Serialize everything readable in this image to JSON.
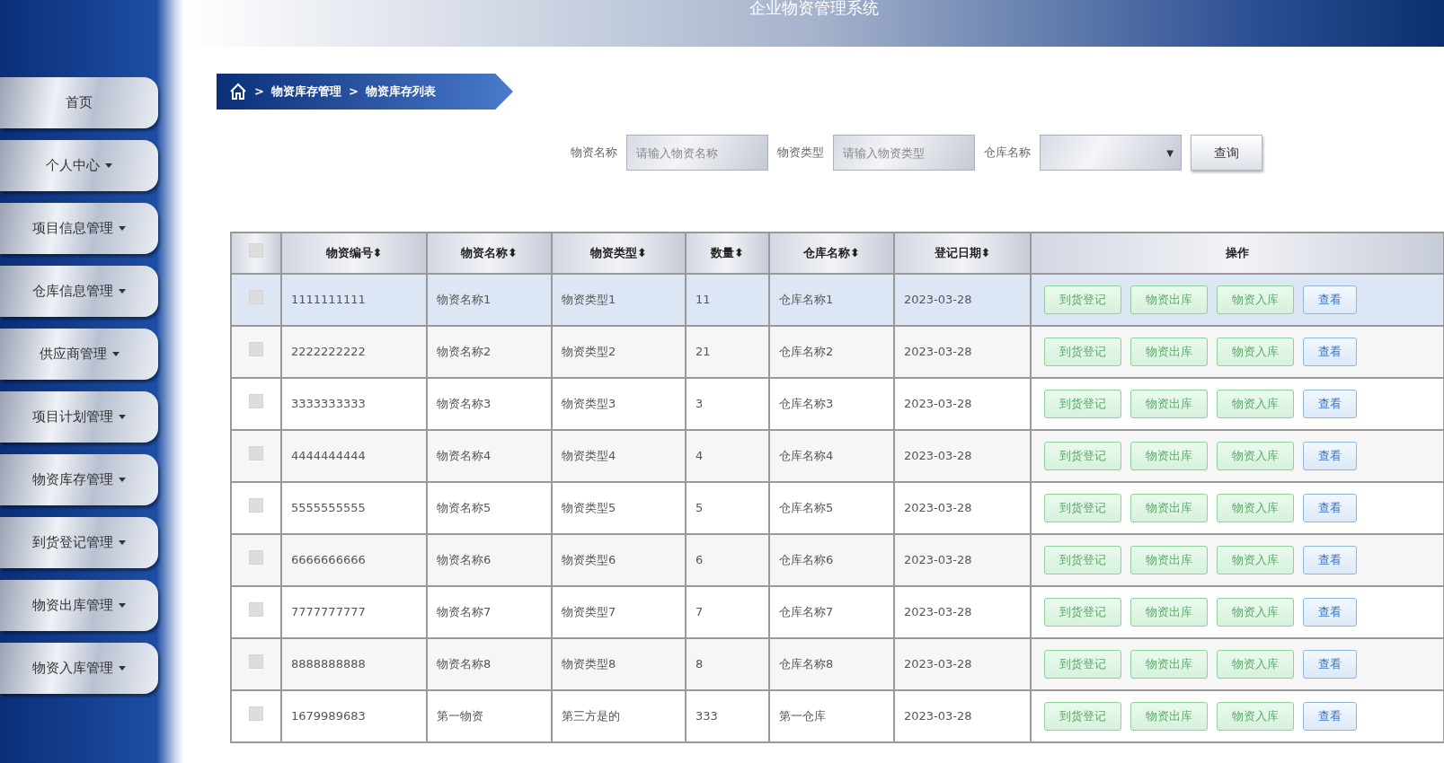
{
  "header": {
    "title": "企业物资管理系统"
  },
  "sidebar": {
    "items": [
      {
        "label": "首页",
        "kind": "link"
      },
      {
        "label": "个人中心",
        "kind": "menu"
      },
      {
        "label": "项目信息管理",
        "kind": "menu"
      },
      {
        "label": "仓库信息管理",
        "kind": "menu"
      },
      {
        "label": "供应商管理",
        "kind": "menu"
      },
      {
        "label": "项目计划管理",
        "kind": "menu"
      },
      {
        "label": "物资库存管理",
        "kind": "menu"
      },
      {
        "label": "到货登记管理",
        "kind": "menu"
      },
      {
        "label": "物资出库管理",
        "kind": "menu"
      },
      {
        "label": "物资入库管理",
        "kind": "menu"
      }
    ]
  },
  "breadcrumb": {
    "separator": ">",
    "items": [
      "物资库存管理",
      "物资库存列表"
    ]
  },
  "search": {
    "fields": [
      {
        "kind": "input",
        "label": "物资名称",
        "placeholder": "请输入物资名称"
      },
      {
        "kind": "input",
        "label": "物资类型",
        "placeholder": "请输入物资类型"
      },
      {
        "kind": "select",
        "label": "仓库名称",
        "caret": "▼"
      }
    ],
    "button": "查询"
  },
  "table": {
    "select_all_checked": false,
    "columns": [
      {
        "label": "物资编号",
        "sort_icon": "⬍"
      },
      {
        "label": "物资名称",
        "sort_icon": "⬍"
      },
      {
        "label": "物资类型",
        "sort_icon": "⬍"
      },
      {
        "label": "数量",
        "sort_icon": "⬍"
      },
      {
        "label": "仓库名称",
        "sort_icon": "⬍"
      },
      {
        "label": "登记日期",
        "sort_icon": "⬍"
      },
      {
        "label": "操作"
      }
    ],
    "rows": [
      {
        "cells": [
          "1111111111",
          "物资名称1",
          "物资类型1",
          "11",
          "仓库名称1",
          "2023-03-28"
        ],
        "selected": true,
        "checked": false,
        "actions": [
          {
            "label": "到货登记",
            "kind": "success"
          },
          {
            "label": "物资出库",
            "kind": "success"
          },
          {
            "label": "物资入库",
            "kind": "success"
          },
          {
            "label": "查看",
            "kind": "info"
          }
        ]
      },
      {
        "cells": [
          "2222222222",
          "物资名称2",
          "物资类型2",
          "21",
          "仓库名称2",
          "2023-03-28"
        ],
        "selected": false,
        "checked": false,
        "actions": [
          {
            "label": "到货登记",
            "kind": "success"
          },
          {
            "label": "物资出库",
            "kind": "success"
          },
          {
            "label": "物资入库",
            "kind": "success"
          },
          {
            "label": "查看",
            "kind": "info"
          }
        ]
      },
      {
        "cells": [
          "3333333333",
          "物资名称3",
          "物资类型3",
          "3",
          "仓库名称3",
          "2023-03-28"
        ],
        "selected": false,
        "checked": false,
        "actions": [
          {
            "label": "到货登记",
            "kind": "success"
          },
          {
            "label": "物资出库",
            "kind": "success"
          },
          {
            "label": "物资入库",
            "kind": "success"
          },
          {
            "label": "查看",
            "kind": "info"
          }
        ]
      },
      {
        "cells": [
          "4444444444",
          "物资名称4",
          "物资类型4",
          "4",
          "仓库名称4",
          "2023-03-28"
        ],
        "selected": false,
        "checked": false,
        "actions": [
          {
            "label": "到货登记",
            "kind": "success"
          },
          {
            "label": "物资出库",
            "kind": "success"
          },
          {
            "label": "物资入库",
            "kind": "success"
          },
          {
            "label": "查看",
            "kind": "info"
          }
        ]
      },
      {
        "cells": [
          "5555555555",
          "物资名称5",
          "物资类型5",
          "5",
          "仓库名称5",
          "2023-03-28"
        ],
        "selected": false,
        "checked": false,
        "actions": [
          {
            "label": "到货登记",
            "kind": "success"
          },
          {
            "label": "物资出库",
            "kind": "success"
          },
          {
            "label": "物资入库",
            "kind": "success"
          },
          {
            "label": "查看",
            "kind": "info"
          }
        ]
      },
      {
        "cells": [
          "6666666666",
          "物资名称6",
          "物资类型6",
          "6",
          "仓库名称6",
          "2023-03-28"
        ],
        "selected": false,
        "checked": false,
        "actions": [
          {
            "label": "到货登记",
            "kind": "success"
          },
          {
            "label": "物资出库",
            "kind": "success"
          },
          {
            "label": "物资入库",
            "kind": "success"
          },
          {
            "label": "查看",
            "kind": "info"
          }
        ]
      },
      {
        "cells": [
          "7777777777",
          "物资名称7",
          "物资类型7",
          "7",
          "仓库名称7",
          "2023-03-28"
        ],
        "selected": false,
        "checked": false,
        "actions": [
          {
            "label": "到货登记",
            "kind": "success"
          },
          {
            "label": "物资出库",
            "kind": "success"
          },
          {
            "label": "物资入库",
            "kind": "success"
          },
          {
            "label": "查看",
            "kind": "info"
          }
        ]
      },
      {
        "cells": [
          "8888888888",
          "物资名称8",
          "物资类型8",
          "8",
          "仓库名称8",
          "2023-03-28"
        ],
        "selected": false,
        "checked": false,
        "actions": [
          {
            "label": "到货登记",
            "kind": "success"
          },
          {
            "label": "物资出库",
            "kind": "success"
          },
          {
            "label": "物资入库",
            "kind": "success"
          },
          {
            "label": "查看",
            "kind": "info"
          }
        ]
      },
      {
        "cells": [
          "1679989683",
          "第一物资",
          "第三方是的",
          "333",
          "第一仓库",
          "2023-03-28"
        ],
        "selected": false,
        "checked": false,
        "actions": [
          {
            "label": "到货登记",
            "kind": "success"
          },
          {
            "label": "物资出库",
            "kind": "success"
          },
          {
            "label": "物资入库",
            "kind": "success"
          },
          {
            "label": "查看",
            "kind": "info"
          }
        ]
      }
    ]
  }
}
